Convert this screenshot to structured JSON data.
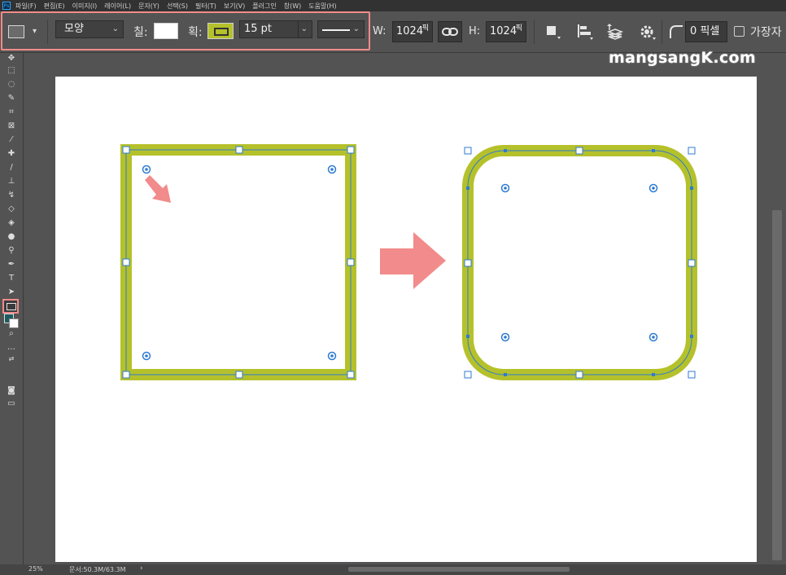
{
  "menu": {
    "items": [
      "파일(F)",
      "편집(E)",
      "이미지(I)",
      "레이어(L)",
      "문자(Y)",
      "선택(S)",
      "필터(T)",
      "보기(V)",
      "플러그인",
      "창(W)",
      "도움말(H)"
    ],
    "app_icon": "Ps"
  },
  "options": {
    "mode_dropdown": "모양",
    "fill_label": "칠:",
    "stroke_label": "획:",
    "stroke_width": "15 pt",
    "width_label": "W:",
    "width_value": "1024",
    "width_unit": "픽",
    "height_label": "H:",
    "height_value": "1024",
    "height_unit": "픽",
    "corner_radius": "0 픽셀",
    "align_edges_label": "가장자",
    "fill_color": "#ffffff",
    "stroke_color": "#b5c12a"
  },
  "watermark": "mangsangK.com",
  "tools": [
    "move-tool",
    "marquee-tool",
    "lasso-tool",
    "quick-select-tool",
    "crop-tool",
    "frame-tool",
    "eyedropper-tool",
    "healing-brush-tool",
    "brush-tool",
    "clone-stamp-tool",
    "history-brush-tool",
    "eraser-tool",
    "paint-bucket-tool",
    "blur-tool",
    "dodge-tool",
    "pen-tool",
    "type-tool",
    "path-select-tool",
    "rectangle-tool",
    "hand-tool",
    "zoom-tool",
    "more-tools"
  ],
  "toolbar_type_glyph": "T",
  "colors": {
    "foreground": "#1e5c63",
    "background": "#ffffff",
    "accent_highlight": "#f28b8b",
    "shape_stroke": "#b5c12a",
    "path_blue": "#2f7bd1"
  },
  "status": {
    "zoom": "25%",
    "doc_info": "문서:50.3M/63.3M",
    "arrow": "›"
  }
}
